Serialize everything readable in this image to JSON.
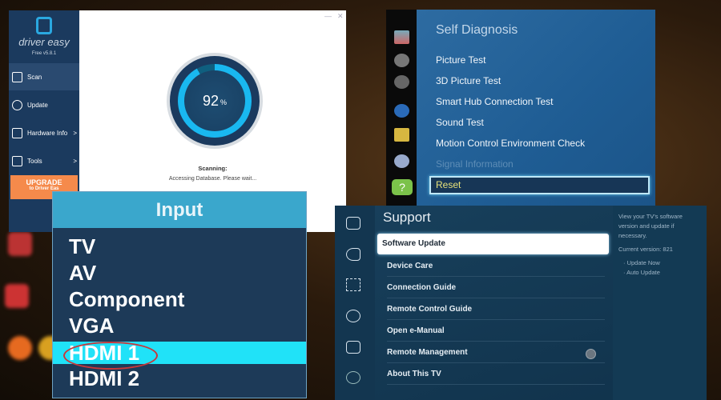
{
  "driver_easy": {
    "brand": "driver easy",
    "version": "Free v5.8.1",
    "nav": [
      {
        "label": "Scan",
        "icon": "scan-icon",
        "active": true
      },
      {
        "label": "Update",
        "icon": "update-icon"
      },
      {
        "label": "Hardware Info",
        "icon": "hardware-info-icon",
        "chevron": ">"
      },
      {
        "label": "Tools",
        "icon": "tools-icon",
        "chevron": ">"
      }
    ],
    "upgrade": {
      "title": "UPGRADE",
      "subtitle": "to Driver Eas"
    },
    "progress_value": "92",
    "progress_unit": "%",
    "progress_fraction": 0.92,
    "status_title": "Scanning:",
    "status_text": "Accessing Database. Please wait...",
    "minimize": "—",
    "close": "✕"
  },
  "input_menu": {
    "title": "Input",
    "items": [
      "TV",
      "AV",
      "Component",
      "VGA",
      "HDMI 1",
      "HDMI 2"
    ],
    "selected": "HDMI 1",
    "highlight_color": "#20e2f8",
    "circle_color": "#c8383a"
  },
  "self_diagnosis": {
    "title": "Self Diagnosis",
    "items": [
      "Picture Test",
      "3D Picture Test",
      "Smart Hub Connection Test",
      "Sound Test",
      "Motion Control Environment Check",
      "Signal Information"
    ],
    "disabled": "Signal Information",
    "selected": "Reset"
  },
  "support": {
    "title": "Support",
    "selected": "Software Update",
    "items": [
      "Device Care",
      "Connection Guide",
      "Remote Control Guide",
      "Open e-Manual",
      "Remote Management",
      "About This TV"
    ],
    "info": {
      "description": "View your TV's software version and update if necessary.",
      "current_version": "Current version: 821",
      "options": [
        "· Update Now",
        "· Auto Update"
      ]
    }
  }
}
